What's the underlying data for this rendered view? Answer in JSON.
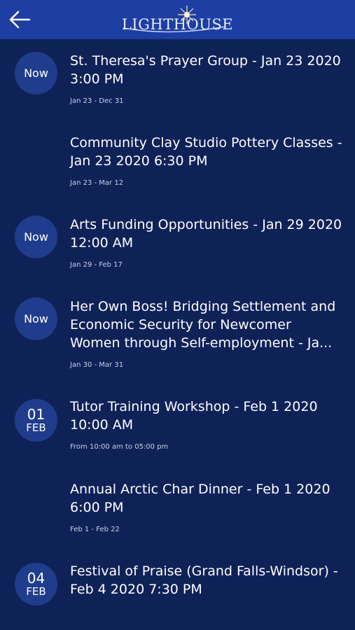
{
  "header": {
    "back_icon": "arrow-left-icon",
    "logo_text": "LIGHTHOUSE"
  },
  "events": [
    {
      "badge": "Now",
      "title": "St. Theresa's Prayer Group - Jan 23 2020 3:00 PM",
      "sub": "Jan 23 - Dec 31"
    },
    {
      "badge": "",
      "title": "Community Clay Studio Pottery Classes - Jan 23 2020 6:30 PM",
      "sub": "Jan 23 - Mar 12"
    },
    {
      "badge": "Now",
      "title": "Arts Funding Opportunities - Jan 29 2020 12:00 AM",
      "sub": "Jan 29 - Feb 17"
    },
    {
      "badge": "Now",
      "title": "Her Own Boss! Bridging Settlement and Economic Security for Newcomer Women through Self-employment - Ja...",
      "sub": "Jan 30 - Mar 31"
    },
    {
      "day": "01",
      "month": "FEB",
      "title": "Tutor Training Workshop - Feb 1 2020 10:00 AM",
      "sub": "From 10:00 am to 05:00 pm"
    },
    {
      "badge": "",
      "title": "Annual Arctic Char Dinner - Feb 1 2020 6:00 PM",
      "sub": "Feb 1 - Feb 22"
    },
    {
      "day": "04",
      "month": "FEB",
      "title": "Festival of Praise (Grand Falls-Windsor) - Feb 4 2020 7:30 PM",
      "sub": ""
    }
  ],
  "colors": {
    "header_bg": "#1d3ea3",
    "page_bg": "#0f2258",
    "circle_bg": "#1f3d8c"
  }
}
